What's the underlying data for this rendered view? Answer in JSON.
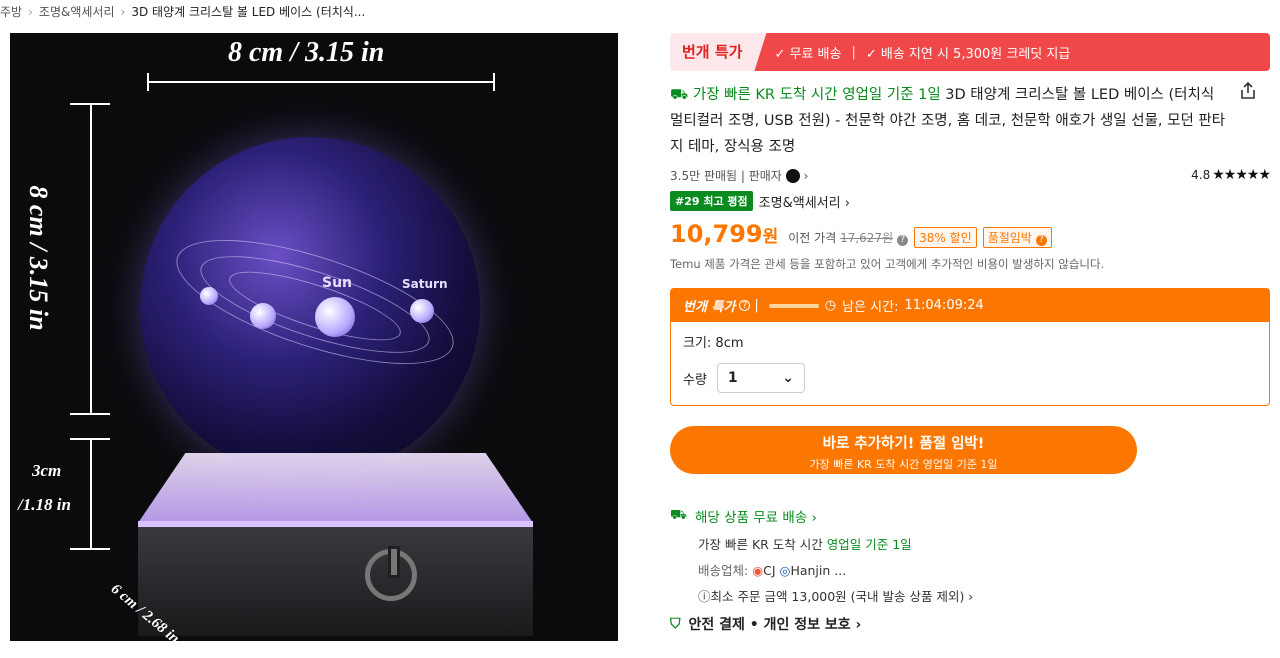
{
  "breadcrumb": {
    "item1": "주방",
    "item2": "조명&액세서리",
    "current": "3D 태양계 크리스탈 볼 LED 베이스 (터치식..."
  },
  "image": {
    "width_label": "8 cm / 3.15 in",
    "height_label": "8 cm / 3.15 in",
    "base_height_label_1": "3cm",
    "base_height_label_2": "/1.18 in",
    "base_width_label": "6 cm / 2.68 in",
    "planet_labels": [
      "Sun",
      "Saturn"
    ]
  },
  "flash_banner": {
    "tag": "번개 특가",
    "free_shipping": "✓ 무료 배송",
    "delay_credit": "✓ 배송 지연 시 5,300원 크레딧 지급"
  },
  "product": {
    "delivery_prefix": "⛟ 가장 빠른 KR 도착 시간 영업일 기준 1일",
    "title": " 3D 태양계 크리스탈 볼 LED 베이스 (터치식 멀티컬러 조명, USB 전원) - 천문학 야간 조명, 홈 데코, 천문학 애호가 생일 선물, 모던 판타지 테마, 장식용 조명",
    "sold": "3.5만 판매됨 | 판매자",
    "rating": "4.8",
    "stars": "★★★★★",
    "best_badge": "#29 최고 평점",
    "category": "조명&액세서리 ›"
  },
  "price": {
    "current": "10,799",
    "currency": "원",
    "prev_label": "이전 가격",
    "prev_value": "17,627원",
    "discount": "38% 할인",
    "stock": "품절임박",
    "notice": "Temu 제품 가격은 관세 등을 포함하고 있어 고객에게 추가적인 비용이 발생하지 않습니다."
  },
  "flash_panel": {
    "label": "번개 특가",
    "timer_label": "남은 시간:",
    "timer_value": "11:04:09:24",
    "size_label": "크기: 8cm",
    "qty_label": "수량",
    "qty_value": "1"
  },
  "cta": {
    "main": "바로 추가하기! 품절 임박!",
    "sub": "가장 빠른 KR 도착 시간 영업일 기준 1일"
  },
  "shipping": {
    "head": "해당 상품 무료 배송 ›",
    "fastest_prefix": "가장 빠른 KR 도착 시간 ",
    "fastest_green": "영업일 기준 1일",
    "carrier_label": "배송업체:",
    "carrier_1": "CJ",
    "carrier_2": "Hanjin",
    "carrier_more": "...",
    "min_order": "최소 주문 금액 13,000원 (국내 발송 상품 제외) ›",
    "secure": "안전 결제 • 개인 정보 보호 ›"
  },
  "colors": {
    "accent": "#fb7701",
    "green": "#0a8a1f",
    "red": "#f04848"
  }
}
